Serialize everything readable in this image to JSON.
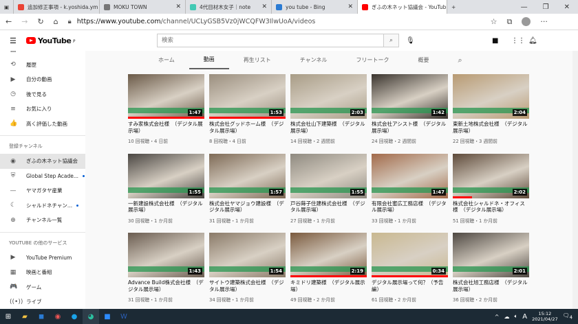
{
  "browser": {
    "tabs": [
      {
        "label": "追加修正事項 - k.yoshida.ym",
        "color": "#ea4335",
        "active": false
      },
      {
        "label": "MOKU TOWN",
        "color": "#777777",
        "active": false
      },
      {
        "label": "4代目材木女子｜note",
        "color": "#41c9b4",
        "active": false
      },
      {
        "label": "you tube - Bing",
        "color": "#2b7bd3",
        "active": false
      },
      {
        "label": "ぎふの木ネット協議会 - YouTub",
        "color": "#ff0000",
        "active": true
      }
    ],
    "url_prefix": "https://www.youtube.com",
    "url_path": "/channel/UCLyGSB5Vz0jWCQFW3IlwUoA/videos"
  },
  "header": {
    "logo": "YouTube",
    "logo_sup": "JP",
    "search_placeholder": "検索"
  },
  "sidebar": {
    "items": [
      {
        "icon": "⟲",
        "label": "履歴"
      },
      {
        "icon": "▶",
        "label": "自分の動画"
      },
      {
        "icon": "◷",
        "label": "後で見る"
      },
      {
        "icon": "≡",
        "label": "お気に入り"
      },
      {
        "icon": "👍",
        "label": "高く評価した動画"
      }
    ],
    "subs_heading": "登録チャンネル",
    "subs": [
      {
        "label": "ぎふの木ネット協議会",
        "new": false,
        "selected": true
      },
      {
        "label": "Global Step Acade...",
        "new": true
      },
      {
        "label": "ヤマガタヤ産業",
        "new": false
      },
      {
        "label": "シャルドネチャン...",
        "new": true
      },
      {
        "label": "チャンネル一覧",
        "new": false
      }
    ],
    "more_heading": "YOUTUBE の他のサービス",
    "more": [
      {
        "icon": "▶",
        "label": "YouTube Premium"
      },
      {
        "icon": "▦",
        "label": "映画と番組"
      },
      {
        "icon": "🎮",
        "label": "ゲーム"
      },
      {
        "icon": "((•))",
        "label": "ライブ"
      }
    ]
  },
  "channel_tabs": [
    "ホーム",
    "動画",
    "再生リスト",
    "チャンネル",
    "フリートーク",
    "概要"
  ],
  "active_tab": "動画",
  "videos": [
    {
      "title": "すみ家株式会社様　（デジタル展示場）",
      "meta": "10 回視聴・4 日前",
      "duration": "1:47",
      "progress": 1.0,
      "bg": "#6b5a48"
    },
    {
      "title": "株式会社グッドホーム様　（デジタル展示場）",
      "meta": "8 回視聴・4 日前",
      "duration": "1:53",
      "progress": 1.0,
      "bg": "#9a8e7e"
    },
    {
      "title": "株式会社山下建築様　（デジタル展示場）",
      "meta": "14 回視聴・2 週間前",
      "duration": "2:03",
      "progress": 0,
      "bg": "#a89c86"
    },
    {
      "title": "株式会社アシスト様　（デジタル展示場）",
      "meta": "24 回視聴・2 週間前",
      "duration": "1:42",
      "progress": 0,
      "bg": "#3a342e"
    },
    {
      "title": "東新土地株式会社様　（デジタル展示場）",
      "meta": "22 回視聴・3 週間前",
      "duration": "2:04",
      "progress": 0,
      "bg": "#b89a72"
    },
    {
      "title": "一新建設株式会社様　（デジタル展示場）",
      "meta": "30 回視聴・1 か月前",
      "duration": "1:55",
      "progress": 0,
      "bg": "#4a4642"
    },
    {
      "title": "株式会社ヤマジョウ建設様　（デジタル展示場）",
      "meta": "31 回視聴・1 か月前",
      "duration": "1:57",
      "progress": 0,
      "bg": "#7e6a56"
    },
    {
      "title": "戸谷蒔子住建株式会社様　（デジタル展示場）",
      "meta": "27 回視聴・1 か月前",
      "duration": "1:55",
      "progress": 0,
      "bg": "#8f8a80"
    },
    {
      "title": "有限会社蜜広工務店様　（デジタル展示場）",
      "meta": "33 回視聴・1 か月前",
      "duration": "1:47",
      "progress": 0,
      "bg": "#a26a4a"
    },
    {
      "title": "株式会社シャルドネ・オフィス様　（デジタル展示場）",
      "meta": "51 回視聴・1 か月前",
      "duration": "2:02",
      "progress": 0.25,
      "bg": "#5e4a3a"
    },
    {
      "title": "Advance Build株式会社様　（デジタル展示場）",
      "meta": "31 回視聴・1 か月前",
      "duration": "1:43",
      "progress": 0,
      "bg": "#6a5c50"
    },
    {
      "title": "サイトウ建築株式会社様　（デジタル展示場）",
      "meta": "34 回視聴・1 か月前",
      "duration": "1:54",
      "progress": 0,
      "bg": "#8a7a68"
    },
    {
      "title": "キミドリ建築様　（デジタル展示場）",
      "meta": "49 回視聴・2 か月前",
      "duration": "2:19",
      "progress": 1.0,
      "bg": "#7a5a3e"
    },
    {
      "title": "デジタル展示場って何？（予告編）",
      "meta": "61 回視聴・2 か月前",
      "duration": "0:34",
      "progress": 1.0,
      "bg": "#c9b890"
    },
    {
      "title": "株式会社旭工務店様　（デジタル展示場）",
      "meta": "36 回視聴・2 か月前",
      "duration": "2:01",
      "progress": 0,
      "bg": "#4e4842"
    }
  ],
  "taskbar": {
    "time": "15:12",
    "date": "2021/04/27",
    "ime": "A",
    "notifications": "4"
  }
}
